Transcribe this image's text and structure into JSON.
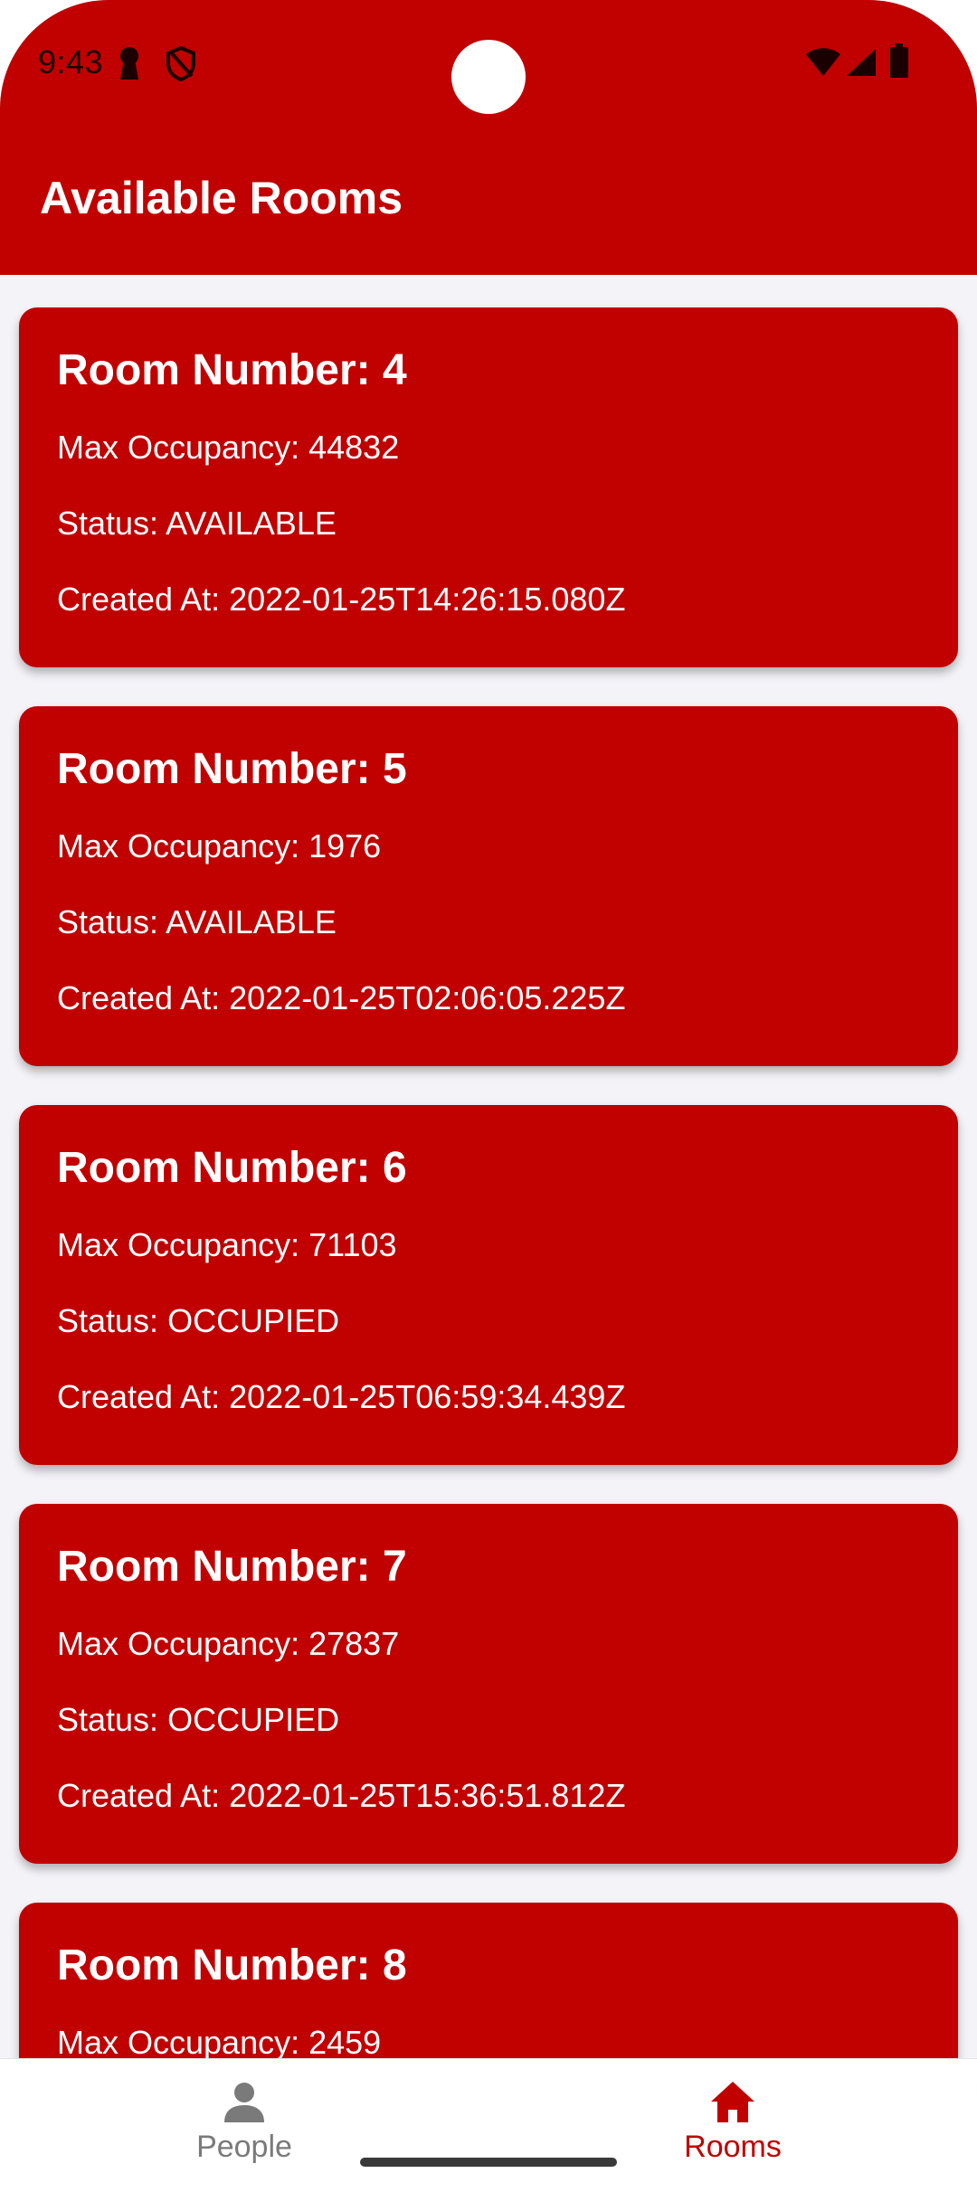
{
  "status_bar": {
    "time": "9:43",
    "icons": [
      "keyhole-icon",
      "shield-icon",
      "wifi-icon",
      "signal-icon",
      "battery-icon"
    ]
  },
  "app_bar": {
    "title": "Available Rooms"
  },
  "rooms": [
    {
      "title": "Room Number: 4",
      "max_occupancy": "Max Occupancy: 44832",
      "status": "Status: AVAILABLE",
      "created_at": "Created At: 2022-01-25T14:26:15.080Z"
    },
    {
      "title": "Room Number: 5",
      "max_occupancy": "Max Occupancy: 1976",
      "status": "Status: AVAILABLE",
      "created_at": "Created At: 2022-01-25T02:06:05.225Z"
    },
    {
      "title": "Room Number: 6",
      "max_occupancy": "Max Occupancy: 71103",
      "status": "Status: OCCUPIED",
      "created_at": "Created At: 2022-01-25T06:59:34.439Z"
    },
    {
      "title": "Room Number: 7",
      "max_occupancy": "Max Occupancy: 27837",
      "status": "Status: OCCUPIED",
      "created_at": "Created At: 2022-01-25T15:36:51.812Z"
    },
    {
      "title": "Room Number: 8",
      "max_occupancy": "Max Occupancy: 2459",
      "status": "",
      "created_at": ""
    }
  ],
  "bottom_nav": {
    "items": [
      {
        "label": "People",
        "icon": "person-icon",
        "active": false
      },
      {
        "label": "Rooms",
        "icon": "home-icon",
        "active": true
      }
    ]
  },
  "colors": {
    "primary": "#c10000",
    "background": "#f4f3f8",
    "on_primary": "#ffffff",
    "nav_inactive": "#7a7a7a",
    "nav_active": "#c10000"
  }
}
